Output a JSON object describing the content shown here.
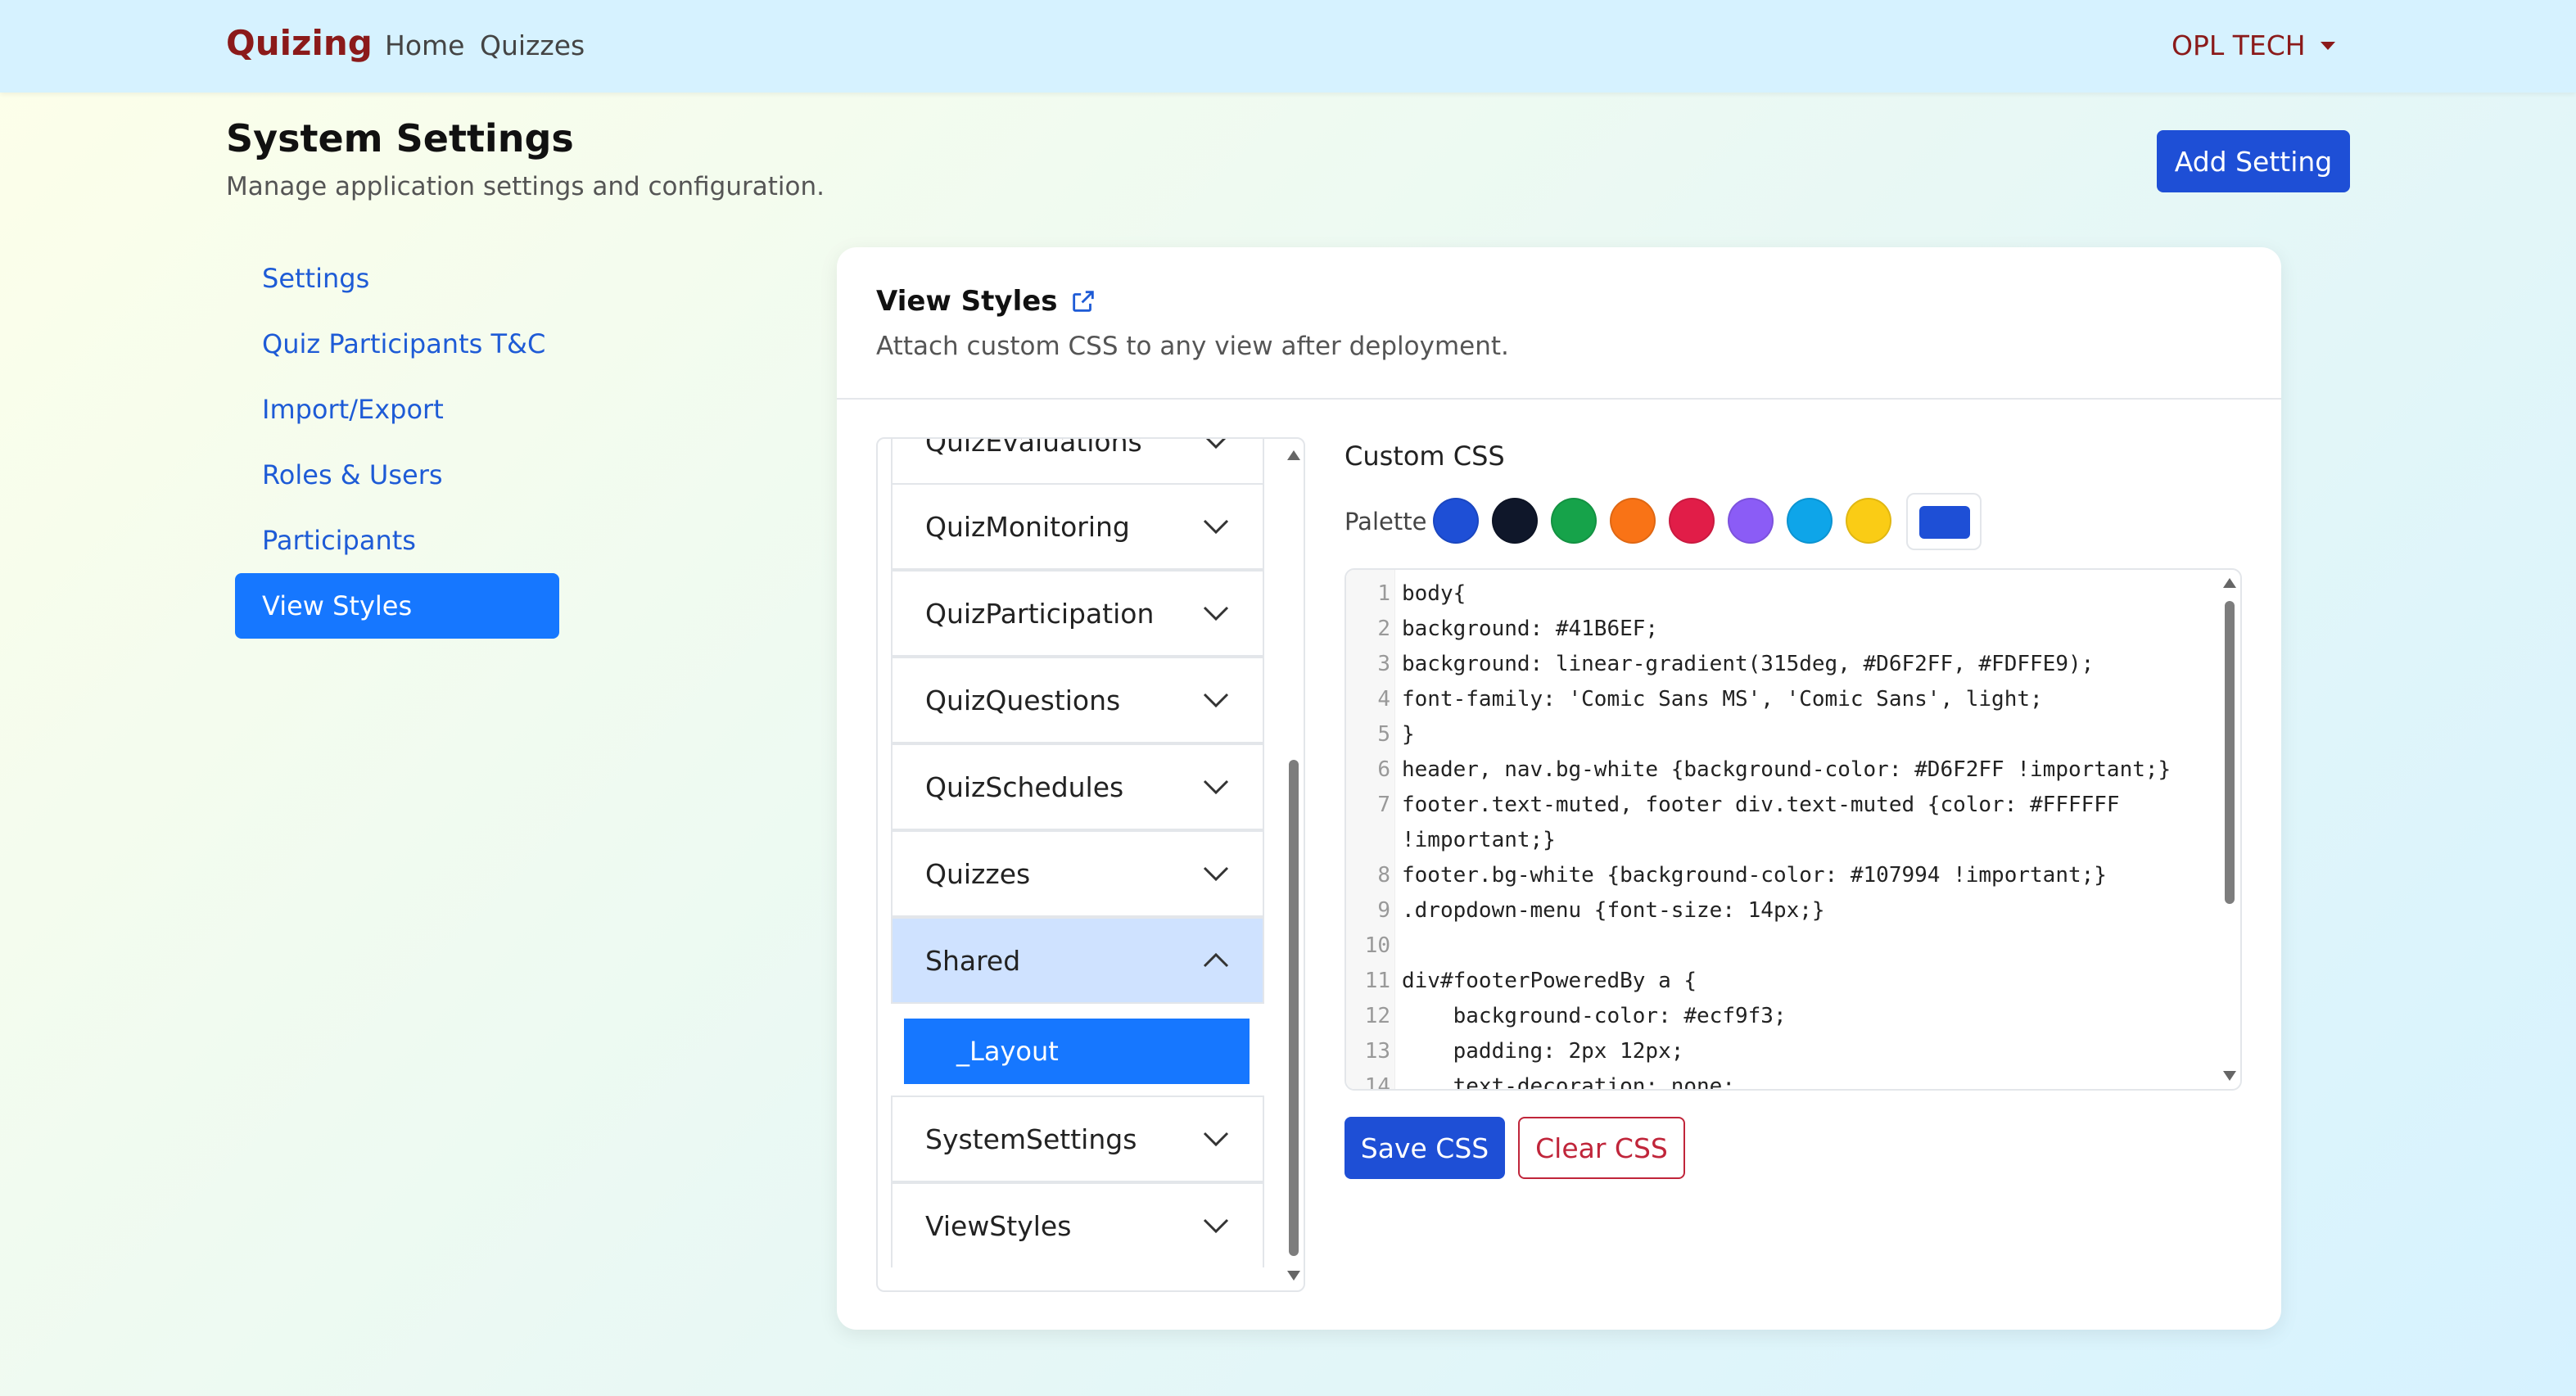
{
  "navbar": {
    "brand": "Quizing",
    "links": [
      "Home",
      "Quizzes"
    ],
    "user": "OPL TECH"
  },
  "header": {
    "title": "System Settings",
    "subtitle": "Manage application settings and configuration.",
    "add_button": "Add Setting"
  },
  "sidebar": {
    "items": [
      "Settings",
      "Quiz Participants T&C",
      "Import/Export",
      "Roles & Users",
      "Participants",
      "View Styles"
    ],
    "active": "View Styles"
  },
  "card": {
    "title": "View Styles",
    "subtitle": "Attach custom CSS to any view after deployment."
  },
  "views": {
    "items": [
      "QuizEvaluations",
      "QuizMonitoring",
      "QuizParticipation",
      "QuizQuestions",
      "QuizSchedules",
      "Quizzes",
      "Shared",
      "SystemSettings",
      "ViewStyles"
    ],
    "open": "Shared",
    "sub_item": "_Layout"
  },
  "editor": {
    "label": "Custom CSS",
    "palette_label": "Palette",
    "palette": [
      "#1E4FD6",
      "#0F172A",
      "#16A34A",
      "#F97316",
      "#E11D48",
      "#8B5CF6",
      "#0EA5E9",
      "#FACC15"
    ],
    "picker_color": "#1E4FD6",
    "lines": [
      {
        "n": "1",
        "t": "body{"
      },
      {
        "n": "2",
        "t": "background: #41B6EF;"
      },
      {
        "n": "3",
        "t": "background: linear-gradient(315deg, #D6F2FF, #FDFFE9);"
      },
      {
        "n": "4",
        "t": "font-family: 'Comic Sans MS', 'Comic Sans', light;"
      },
      {
        "n": "5",
        "t": "}"
      },
      {
        "n": "6",
        "t": "header, nav.bg-white {background-color: #D6F2FF !important;}"
      },
      {
        "n": "7",
        "t": "footer.text-muted, footer div.text-muted {color: #FFFFFF"
      },
      {
        "n": "",
        "t": "!important;}"
      },
      {
        "n": "8",
        "t": "footer.bg-white {background-color: #107994 !important;}"
      },
      {
        "n": "9",
        "t": ".dropdown-menu {font-size: 14px;}"
      },
      {
        "n": "10",
        "t": ""
      },
      {
        "n": "11",
        "t": "div#footerPoweredBy a {"
      },
      {
        "n": "12",
        "t": "    background-color: #ecf9f3;"
      },
      {
        "n": "13",
        "t": "    padding: 2px 12px;"
      },
      {
        "n": "14",
        "t": "    text-decoration: none;"
      }
    ],
    "save_button": "Save CSS",
    "clear_button": "Clear CSS"
  }
}
